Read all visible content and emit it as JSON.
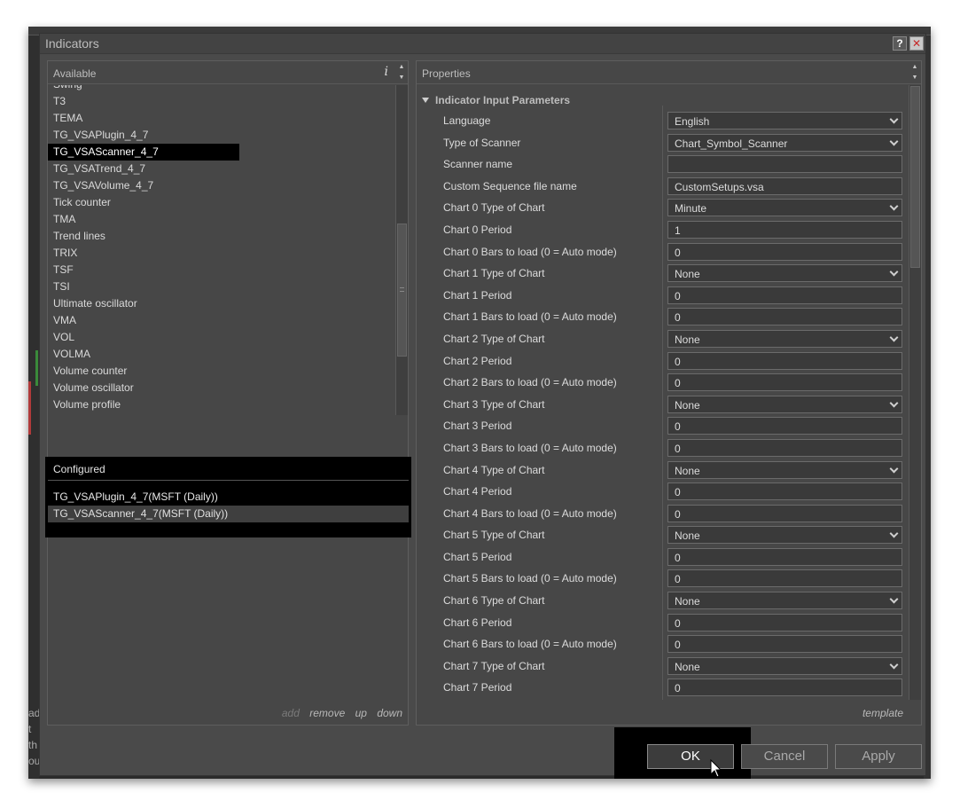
{
  "dialog": {
    "title": "Indicators",
    "help_label": "?",
    "close_label": "✕"
  },
  "available": {
    "header": "Available",
    "info_label": "i",
    "items": [
      "Swing",
      "T3",
      "TEMA",
      "TG_VSAPlugin_4_7",
      "TG_VSAScanner_4_7",
      "TG_VSATrend_4_7",
      "TG_VSAVolume_4_7",
      "Tick counter",
      "TMA",
      "Trend lines",
      "TRIX",
      "TSF",
      "TSI",
      "Ultimate oscillator",
      "VMA",
      "VOL",
      "VOLMA",
      "Volume counter",
      "Volume oscillator",
      "Volume profile"
    ],
    "selected": "TG_VSAScanner_4_7"
  },
  "configured": {
    "header": "Configured",
    "items": [
      "TG_VSAPlugin_4_7(MSFT (Daily))",
      "TG_VSAScanner_4_7(MSFT (Daily))"
    ],
    "selected_index": 1,
    "footer": {
      "add": "add",
      "remove": "remove",
      "up": "up",
      "down": "down"
    }
  },
  "properties": {
    "header": "Properties",
    "category": "Indicator Input Parameters",
    "template_label": "template",
    "rows": [
      {
        "label": "Language",
        "value": "English",
        "dropdown": true
      },
      {
        "label": "Type of Scanner",
        "value": "Chart_Symbol_Scanner",
        "dropdown": true
      },
      {
        "label": "Scanner name",
        "value": "",
        "dropdown": false
      },
      {
        "label": "Custom Sequence file name",
        "value": "CustomSetups.vsa",
        "dropdown": false
      },
      {
        "label": "Chart 0 Type of Chart",
        "value": "Minute",
        "dropdown": true
      },
      {
        "label": "Chart 0 Period",
        "value": "1",
        "dropdown": false
      },
      {
        "label": "Chart 0 Bars to load (0 = Auto mode)",
        "value": "0",
        "dropdown": false
      },
      {
        "label": "Chart 1 Type of Chart",
        "value": "None",
        "dropdown": true
      },
      {
        "label": "Chart 1 Period",
        "value": "0",
        "dropdown": false
      },
      {
        "label": "Chart 1 Bars to load (0 = Auto mode)",
        "value": "0",
        "dropdown": false
      },
      {
        "label": "Chart 2 Type of Chart",
        "value": "None",
        "dropdown": true
      },
      {
        "label": "Chart 2 Period",
        "value": "0",
        "dropdown": false
      },
      {
        "label": "Chart 2 Bars to load (0 = Auto mode)",
        "value": "0",
        "dropdown": false
      },
      {
        "label": "Chart 3 Type of Chart",
        "value": "None",
        "dropdown": true
      },
      {
        "label": "Chart 3 Period",
        "value": "0",
        "dropdown": false
      },
      {
        "label": "Chart 3 Bars to load (0 = Auto mode)",
        "value": "0",
        "dropdown": false
      },
      {
        "label": "Chart 4 Type of Chart",
        "value": "None",
        "dropdown": true
      },
      {
        "label": "Chart 4 Period",
        "value": "0",
        "dropdown": false
      },
      {
        "label": "Chart 4 Bars to load (0 = Auto mode)",
        "value": "0",
        "dropdown": false
      },
      {
        "label": "Chart 5 Type of Chart",
        "value": "None",
        "dropdown": true
      },
      {
        "label": "Chart 5 Period",
        "value": "0",
        "dropdown": false
      },
      {
        "label": "Chart 5 Bars to load (0 = Auto mode)",
        "value": "0",
        "dropdown": false
      },
      {
        "label": "Chart 6 Type of Chart",
        "value": "None",
        "dropdown": true
      },
      {
        "label": "Chart 6 Period",
        "value": "0",
        "dropdown": false
      },
      {
        "label": "Chart 6 Bars to load (0 = Auto mode)",
        "value": "0",
        "dropdown": false
      },
      {
        "label": "Chart 7 Type of Chart",
        "value": "None",
        "dropdown": true
      },
      {
        "label": "Chart 7 Period",
        "value": "0",
        "dropdown": false
      }
    ]
  },
  "buttons": {
    "ok": "OK",
    "cancel": "Cancel",
    "apply": "Apply"
  },
  "background_app": {
    "edge_text": [
      "ad",
      "t th",
      "ou"
    ]
  },
  "colors": {
    "dialog_bg": "#4a4a4a",
    "selection": "#000000",
    "text": "#dcdcdc"
  }
}
